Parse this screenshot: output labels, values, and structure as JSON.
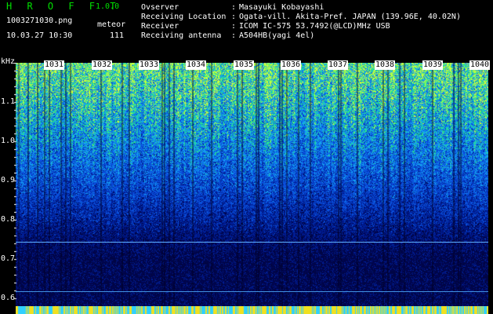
{
  "header": {
    "app_title": "H R O F F T",
    "version": "1.0.0",
    "filename": "1003271030.png",
    "meteor_label": "meteor",
    "datetime": "10.03.27 10:30",
    "meteor_count": "111",
    "info": [
      {
        "label": "Ovserver",
        "value": "Masayuki Kobayashi"
      },
      {
        "label": "Receiving Location",
        "value": "Ogata-vill. Akita-Pref. JAPAN (139.96E, 40.02N)"
      },
      {
        "label": "Receiver",
        "value": "ICOM IC-575 53.7492(@LCD)MHz USB"
      },
      {
        "label": "Receiving antenna",
        "value": "A504HB(yagi 4el)"
      }
    ]
  },
  "axis": {
    "unit": "kHz",
    "y_labels": [
      "1.1",
      "1.0",
      "0.9",
      "0.8",
      "0.7",
      "0.6"
    ],
    "minute_labels": [
      "1031",
      "1032",
      "1033",
      "1034",
      "1035",
      "1036",
      "1037",
      "1038",
      "1039",
      "1040"
    ]
  },
  "colors": {
    "background": "#000000",
    "title_green": "#00e000",
    "text_white": "#ffffff",
    "signal_line": "#40a0ff",
    "spectrogram_low": "#000050",
    "spectrogram_mid": "#0060ff",
    "spectrogram_high": "#40ff80"
  }
}
